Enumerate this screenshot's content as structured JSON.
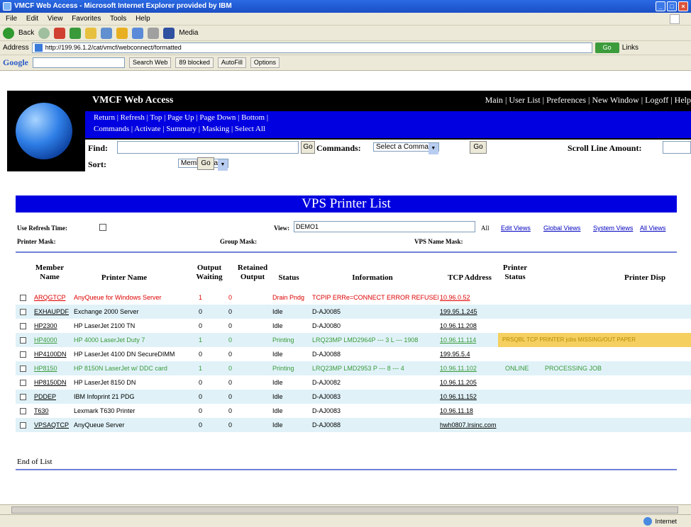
{
  "browser": {
    "title": "VMCF Web Access - Microsoft Internet Explorer provided by IBM",
    "menu": [
      "File",
      "Edit",
      "View",
      "Favorites",
      "Tools",
      "Help"
    ],
    "back_label": "Back",
    "media_label": "Media",
    "address_label": "Address",
    "address_value": "http://199.96.1.2/cat/vmcf/webconnect/formatted",
    "go_label": "Go",
    "links_label": "Links",
    "google": {
      "logo": "Google",
      "search_web": "Search Web",
      "blocked": "89 blocked",
      "autofill": "AutoFill",
      "options": "Options"
    },
    "status_zone": "Internet"
  },
  "app": {
    "title": "VMCF Web Access",
    "top_nav": [
      "Main",
      "User List",
      "Preferences",
      "New Window",
      "Logoff",
      "Help"
    ],
    "nav_row1": [
      "Return",
      "Refresh",
      "Top",
      "Page Up",
      "Page Down",
      "Bottom"
    ],
    "nav_row2": [
      "Commands",
      "Activate",
      "Summary",
      "Masking",
      "Select All"
    ],
    "find_label": "Find:",
    "find_go": "Go",
    "commands_label": "Commands:",
    "commands_select": "Select a Command",
    "commands_go": "Go",
    "scroll_label": "Scroll Line Amount:",
    "sort_label": "Sort:",
    "sort_select": "Member Name",
    "sort_go": "Go"
  },
  "list": {
    "title": "VPS Printer List",
    "use_refresh_label": "Use Refresh Time:",
    "view_label": "View:",
    "view_value": "DEMO1",
    "all_label": "All",
    "view_links": [
      "Edit Views",
      "Global Views",
      "System Views",
      "All Views"
    ],
    "printer_mask_label": "Printer Mask:",
    "group_mask_label": "Group Mask:",
    "vps_name_mask_label": "VPS Name Mask:",
    "columns": {
      "member_name": "Member Name",
      "printer_name": "Printer Name",
      "output_waiting": "Output Waiting",
      "retained_output": "Retained Output",
      "status": "Status",
      "information": "Information",
      "tcp_address": "TCP Address",
      "printer_status": "Printer Status",
      "printer_disp": "Printer Disp"
    },
    "rows": [
      {
        "member": "ARQGTCP",
        "printer": "AnyQueue for Windows Server",
        "waiting": "1",
        "retained": "0",
        "status": "Drain Pndg",
        "info": "TCPIP ERRe=CONNECT ERROR REFUSED",
        "tcp": "10.96.0.52",
        "pstatus": "",
        "pdisp": ""
      },
      {
        "member": "EXHAUPDF",
        "printer": "Exchange 2000 Server",
        "waiting": "0",
        "retained": "0",
        "status": "Idle",
        "info": "D-AJ0085",
        "tcp": "199.95.1.245",
        "pstatus": "",
        "pdisp": ""
      },
      {
        "member": "HP2300",
        "printer": "HP LaserJet 2100 TN",
        "waiting": "0",
        "retained": "0",
        "status": "Idle",
        "info": "D-AJ0080",
        "tcp": "10.96.11.208",
        "pstatus": "",
        "pdisp": ""
      },
      {
        "member": "HP4000",
        "printer": "HP 4000 LaserJet Duty 7",
        "waiting": "1",
        "retained": "0",
        "status": "Printing",
        "info": "LRQ23MP LMD2964P --- 3 L --- 1908",
        "tcp": "10.96.11.114",
        "pstatus": "",
        "pdisp": "PRSQBL TCP PRINTER jobs MISSING/OUT PAPER"
      },
      {
        "member": "HP4100DN",
        "printer": "HP LaserJet 4100 DN SecureDIMM",
        "waiting": "0",
        "retained": "0",
        "status": "Idle",
        "info": "D-AJ0088",
        "tcp": "199.95.5.4",
        "pstatus": "",
        "pdisp": ""
      },
      {
        "member": "HP8150",
        "printer": "HP 8150N LaserJet w/ DDC card",
        "waiting": "1",
        "retained": "0",
        "status": "Printing",
        "info": "LRQ23MP LMD2953 P --- 8 --- 4",
        "tcp": "10.96.11.102",
        "pstatus": "ONLINE",
        "pdisp": "PROCESSING JOB"
      },
      {
        "member": "HP8150DN",
        "printer": "HP LaserJet 8150 DN",
        "waiting": "0",
        "retained": "0",
        "status": "Idle",
        "info": "D-AJ0082",
        "tcp": "10.96.11.205",
        "pstatus": "",
        "pdisp": ""
      },
      {
        "member": "PDDEP",
        "printer": "IBM Infoprint 21 PDG",
        "waiting": "0",
        "retained": "0",
        "status": "Idle",
        "info": "D-AJ0083",
        "tcp": "10.96.11.152",
        "pstatus": "",
        "pdisp": ""
      },
      {
        "member": "T630",
        "printer": "Lexmark T630 Printer",
        "waiting": "0",
        "retained": "0",
        "status": "Idle",
        "info": "D-AJ0083",
        "tcp": "10.96.11.18",
        "pstatus": "",
        "pdisp": ""
      },
      {
        "member": "VPSAQTCP",
        "printer": "AnyQueue Server",
        "waiting": "0",
        "retained": "0",
        "status": "Idle",
        "info": "D-AJ0088",
        "tcp": "hwh0807.lrsinc.com",
        "pstatus": "",
        "pdisp": ""
      }
    ],
    "end_text": "End of List"
  }
}
